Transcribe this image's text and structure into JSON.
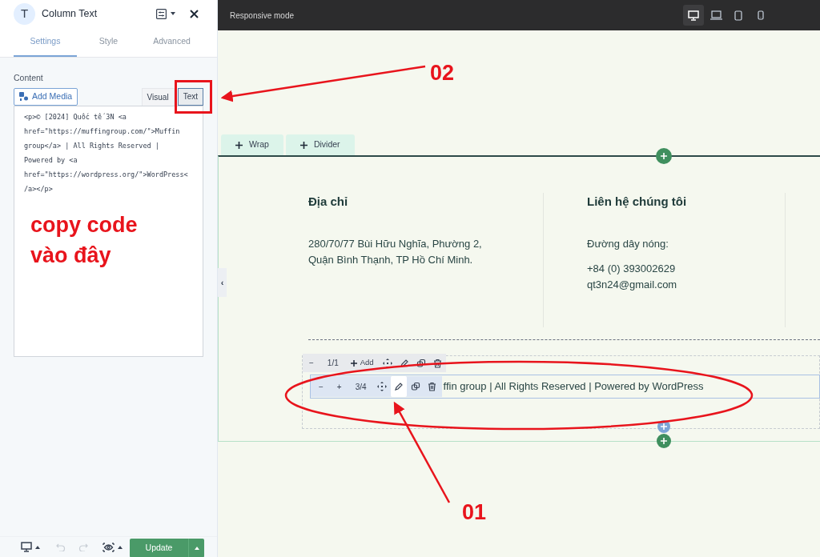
{
  "panel": {
    "icon_letter": "T",
    "title": "Column Text",
    "tabs": [
      {
        "label": "Settings",
        "selected": true
      },
      {
        "label": "Style",
        "selected": false
      },
      {
        "label": "Advanced",
        "selected": false
      }
    ],
    "content_label": "Content",
    "add_media": "Add Media",
    "editor_tabs": [
      {
        "label": "Visual",
        "selected": false
      },
      {
        "label": "Text",
        "selected": true
      }
    ],
    "code_lines": [
      "<p>© [2024] Quốc tế 3N <a",
      "href=\"https://muffingroup.com/\">Muffin",
      "group</a> | All Rights Reserved |",
      "Powered by <a",
      "href=\"https://wordpress.org/\">WordPress<",
      "/a></p>"
    ],
    "collapse": "‹",
    "update": "Update"
  },
  "topbar": {
    "title": "Responsive mode",
    "devices": [
      {
        "kind": "desktop",
        "selected": true
      },
      {
        "kind": "laptop",
        "selected": false
      },
      {
        "kind": "tablet",
        "selected": false
      },
      {
        "kind": "mobile",
        "selected": false
      }
    ]
  },
  "canvas": {
    "add_buttons": [
      "Wrap",
      "Divider"
    ],
    "columns": [
      {
        "heading": "Địa chỉ",
        "lines": [
          "280/70/77 Bùi Hữu Nghĩa, Phường 2,",
          "Quận Bình Thạnh, TP Hồ Chí Minh."
        ]
      },
      {
        "heading": "Liên hệ chúng tôi",
        "lines": [
          "Đường dây nóng:",
          "+84 (0) 393002629",
          "qt3n24@gmail.com"
        ]
      }
    ],
    "footer_text": "ffin group | All Rights Reserved | Powered by WordPress",
    "toolbars": [
      {
        "items": [
          {
            "kind": "text",
            "label": "−",
            "selected": false
          },
          {
            "kind": "text",
            "label": "1/1",
            "selected": false
          },
          {
            "kind": "add",
            "label": "Add",
            "selected": false
          },
          {
            "kind": "move",
            "selected": false
          },
          {
            "kind": "edit",
            "selected": false
          },
          {
            "kind": "copy",
            "selected": false
          },
          {
            "kind": "delete",
            "selected": false
          }
        ]
      },
      {
        "items": [
          {
            "kind": "text",
            "label": "−",
            "selected": false
          },
          {
            "kind": "text",
            "label": "+",
            "selected": false
          },
          {
            "kind": "text",
            "label": "3/4",
            "selected": false
          },
          {
            "kind": "move",
            "selected": false
          },
          {
            "kind": "edit",
            "selected": true
          },
          {
            "kind": "copy",
            "selected": false
          },
          {
            "kind": "delete",
            "selected": false
          }
        ]
      }
    ]
  },
  "annotations": {
    "label_02": "02",
    "label_01": "01",
    "note": "copy code vào đây"
  }
}
